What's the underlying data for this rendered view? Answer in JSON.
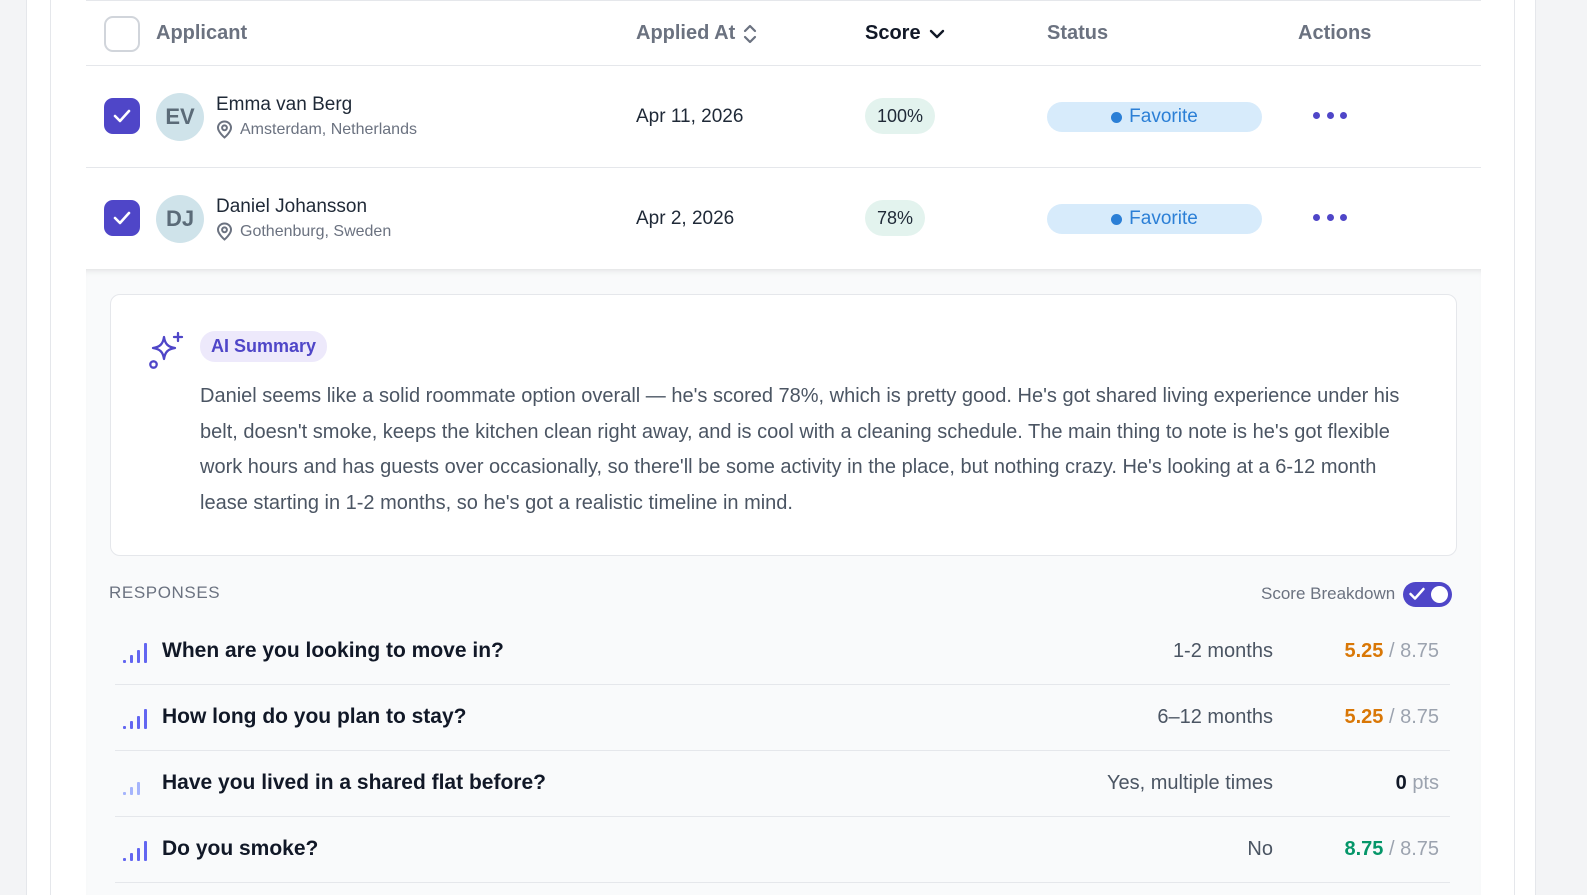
{
  "table": {
    "headers": {
      "applicant": "Applicant",
      "applied_at": "Applied At",
      "score": "Score",
      "status": "Status",
      "actions": "Actions"
    },
    "rows": [
      {
        "initials": "EV",
        "name": "Emma van Berg",
        "location": "Amsterdam, Netherlands",
        "applied_at": "Apr 11, 2026",
        "score": "100%",
        "status": "Favorite",
        "checked": true
      },
      {
        "initials": "DJ",
        "name": "Daniel Johansson",
        "location": "Gothenburg, Sweden",
        "applied_at": "Apr 2, 2026",
        "score": "78%",
        "status": "Favorite",
        "checked": true
      }
    ]
  },
  "ai_summary": {
    "badge": "AI Summary",
    "text": "Daniel seems like a solid roommate option overall — he's scored 78%, which is pretty good. He's got shared living experience under his belt, doesn't smoke, keeps the kitchen clean right away, and is cool with a cleaning schedule. The main thing to note is he's got flexible work hours and has guests over occasionally, so there'll be some activity in the place, but nothing crazy. He's looking at a 6-12 month lease starting in 1-2 months, so he's got a realistic timeline in mind."
  },
  "responses": {
    "title": "RESPONSES",
    "score_breakdown_label": "Score Breakdown",
    "score_breakdown_on": true,
    "items": [
      {
        "question": "When are you looking to move in?",
        "answer": "1-2 months",
        "points": "5.25",
        "max": "/ 8.75",
        "points_color": "#d97706"
      },
      {
        "question": "How long do you plan to stay?",
        "answer": "6–12 months",
        "points": "5.25",
        "max": "/ 8.75",
        "points_color": "#d97706"
      },
      {
        "question": "Have you lived in a shared flat before?",
        "answer": "Yes, multiple times",
        "points": "0",
        "max": "pts",
        "points_color": "#111827"
      },
      {
        "question": "Do you smoke?",
        "answer": "No",
        "points": "8.75",
        "max": "/ 8.75",
        "points_color": "#059669"
      }
    ]
  },
  "colors": {
    "accent": "#4f46c8",
    "status_bg": "#d7ebfb",
    "status_text": "#2b7fd6",
    "score_bg": "#e3f3ee"
  }
}
